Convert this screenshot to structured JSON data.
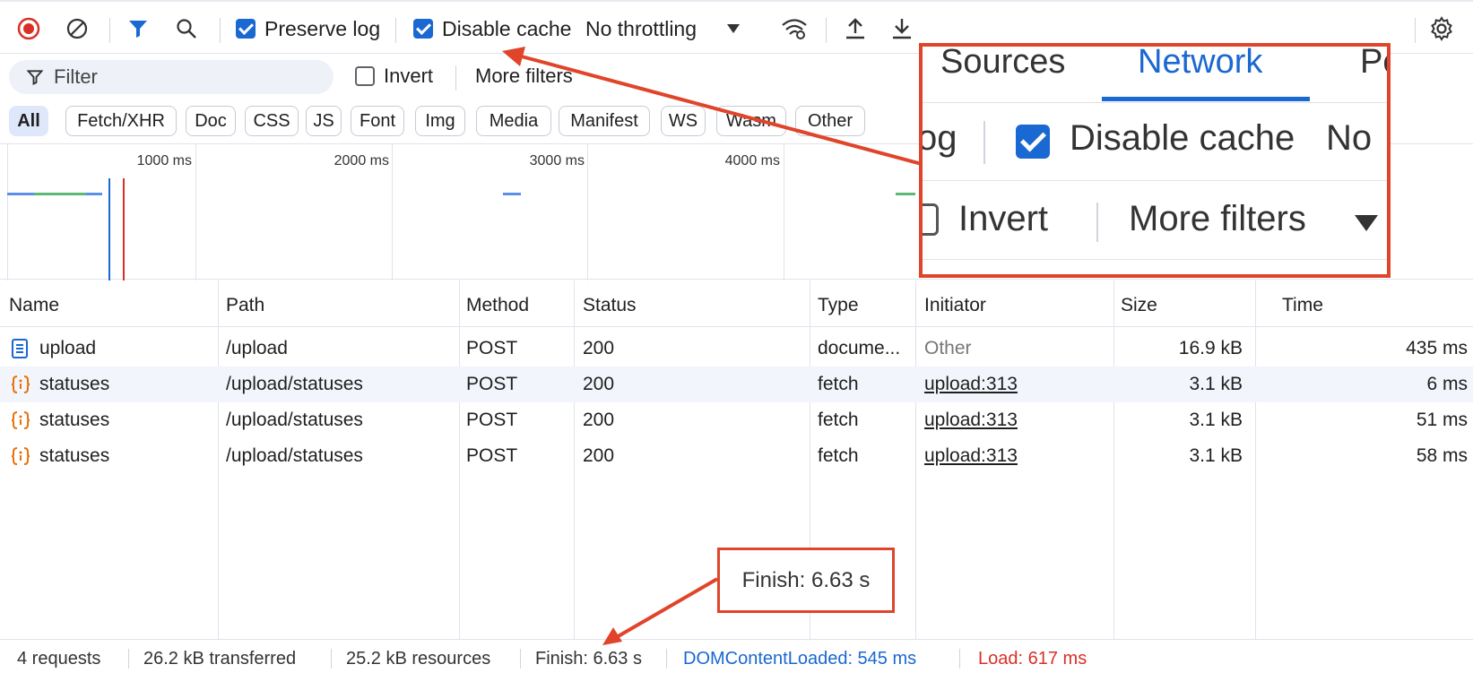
{
  "toolbar": {
    "preserve_log_label": "Preserve log",
    "disable_cache_label": "Disable cache",
    "throttling_value": "No throttling"
  },
  "filter": {
    "placeholder": "Filter",
    "invert_label": "Invert",
    "more_filters_label": "More filters"
  },
  "type_filters": [
    "All",
    "Fetch/XHR",
    "Doc",
    "CSS",
    "JS",
    "Font",
    "Img",
    "Media",
    "Manifest",
    "WS",
    "Wasm",
    "Other"
  ],
  "overview": {
    "ticks": [
      "1000 ms",
      "2000 ms",
      "3000 ms",
      "4000 ms"
    ]
  },
  "table": {
    "headers": [
      "Name",
      "Path",
      "Method",
      "Status",
      "Type",
      "Initiator",
      "Size",
      "Time"
    ],
    "rows": [
      {
        "icon": "document-icon",
        "name": "upload",
        "path": "/upload",
        "method": "POST",
        "status": "200",
        "type": "docume...",
        "initiator": "Other",
        "size": "16.9 kB",
        "time": "435 ms"
      },
      {
        "icon": "fetch-icon",
        "name": "statuses",
        "path": "/upload/statuses",
        "method": "POST",
        "status": "200",
        "type": "fetch",
        "initiator": "upload:313",
        "size": "3.1 kB",
        "time": "6 ms"
      },
      {
        "icon": "fetch-icon",
        "name": "statuses",
        "path": "/upload/statuses",
        "method": "POST",
        "status": "200",
        "type": "fetch",
        "initiator": "upload:313",
        "size": "3.1 kB",
        "time": "51 ms"
      },
      {
        "icon": "fetch-icon",
        "name": "statuses",
        "path": "/upload/statuses",
        "method": "POST",
        "status": "200",
        "type": "fetch",
        "initiator": "upload:313",
        "size": "3.1 kB",
        "time": "58 ms"
      }
    ]
  },
  "statusbar": {
    "requests": "4 requests",
    "transferred": "26.2 kB transferred",
    "resources": "25.2 kB resources",
    "finish": "Finish: 6.63 s",
    "dom_content_loaded": "DOMContentLoaded: 545 ms",
    "load": "Load: 617 ms"
  },
  "zoom": {
    "tab_sources": "Sources",
    "tab_network": "Network",
    "tab_partial": "Pe",
    "log_partial": "og",
    "disable_cache_label": "Disable cache",
    "throttle_partial": "No",
    "invert_label": "Invert",
    "more_filters_label": "More filters"
  },
  "callout": {
    "text": "Finish: 6.63 s"
  },
  "colors": {
    "accent": "#1a68d1",
    "annotation": "#e0452b",
    "dom_loaded": "#1a68d1",
    "load": "#d93025"
  }
}
